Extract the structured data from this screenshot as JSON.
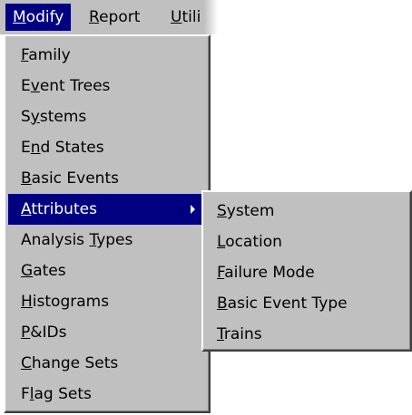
{
  "menubar": {
    "items": [
      {
        "pre": "",
        "key": "M",
        "post": "odify"
      },
      {
        "pre": "",
        "key": "R",
        "post": "eport"
      },
      {
        "pre": "",
        "key": "U",
        "post": "tili"
      }
    ]
  },
  "modify_menu": {
    "items": [
      {
        "pre": "",
        "key": "F",
        "post": "amily"
      },
      {
        "pre": "E",
        "key": "v",
        "post": "ent Trees"
      },
      {
        "pre": "S",
        "key": "y",
        "post": "stems"
      },
      {
        "pre": "E",
        "key": "n",
        "post": "d States"
      },
      {
        "pre": "",
        "key": "B",
        "post": "asic Events"
      },
      {
        "pre": "",
        "key": "A",
        "post": "ttributes"
      },
      {
        "pre": "Analysis ",
        "key": "T",
        "post": "ypes"
      },
      {
        "pre": "",
        "key": "G",
        "post": "ates"
      },
      {
        "pre": "",
        "key": "H",
        "post": "istograms"
      },
      {
        "pre": "",
        "key": "P",
        "post": "&IDs"
      },
      {
        "pre": "",
        "key": "C",
        "post": "hange Sets"
      },
      {
        "pre": "F",
        "key": "l",
        "post": "ag Sets"
      }
    ]
  },
  "attributes_submenu": {
    "items": [
      {
        "pre": "",
        "key": "S",
        "post": "ystem"
      },
      {
        "pre": "",
        "key": "L",
        "post": "ocation"
      },
      {
        "pre": "",
        "key": "F",
        "post": "ailure Mode"
      },
      {
        "pre": "",
        "key": "B",
        "post": "asic Event Type"
      },
      {
        "pre": "",
        "key": "T",
        "post": "rains"
      }
    ]
  },
  "icons": {
    "submenu_arrow": "submenu-arrow-icon"
  },
  "colors": {
    "highlight": "#000080",
    "menu_face": "#c0c0c0",
    "highlight_text": "#ffffff"
  }
}
